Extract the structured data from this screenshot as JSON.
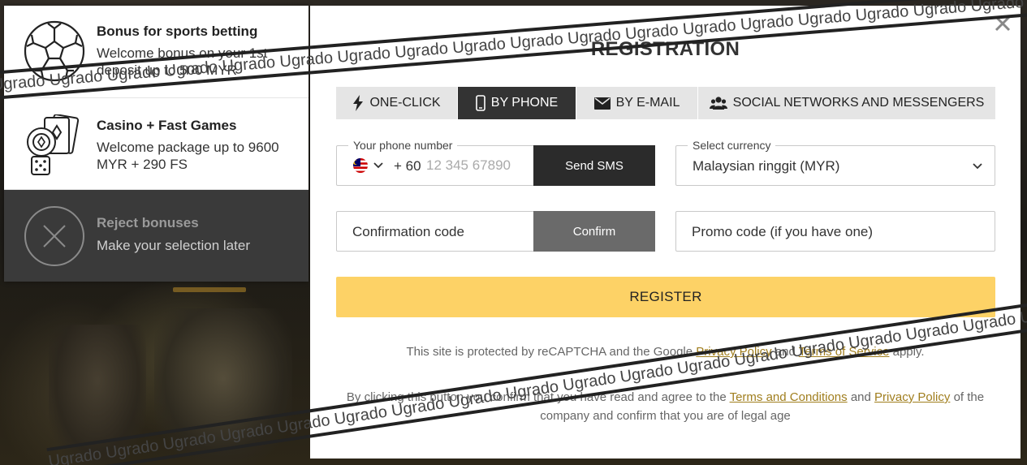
{
  "bonuses": [
    {
      "title": "Bonus for sports betting",
      "desc": "Welcome bonus on your 1st deposit up to 500 MYR",
      "icon": "soccer-ball-icon"
    },
    {
      "title": "Casino + Fast Games",
      "desc": "Welcome package up to 9600 MYR + 290 FS",
      "icon": "casino-chips-cards-dice-icon"
    },
    {
      "title": "Reject bonuses",
      "desc": "Make your selection later",
      "icon": "reject-circle-x-icon"
    }
  ],
  "modal": {
    "title": "REGISTRATION",
    "tabs": [
      {
        "label": "ONE-CLICK",
        "icon": "lightning-icon"
      },
      {
        "label": "BY PHONE",
        "icon": "phone-icon",
        "active": true
      },
      {
        "label": "BY E-MAIL",
        "icon": "envelope-icon"
      },
      {
        "label": "SOCIAL NETWORKS AND MESSENGERS",
        "icon": "users-icon"
      }
    ],
    "phone": {
      "label": "Your phone number",
      "country_code": "+ 60",
      "placeholder": "12 345 67890",
      "send_label": "Send SMS",
      "flag": "malaysia-flag-icon"
    },
    "currency": {
      "label": "Select currency",
      "value": "Malaysian ringgit (MYR)"
    },
    "confirmation": {
      "placeholder": "Confirmation code",
      "button_label": "Confirm"
    },
    "promo": {
      "placeholder": "Promo code (if you have one)"
    },
    "register_label": "REGISTER",
    "recaptcha": {
      "prefix": "This site is protected by reCAPTCHA and the Google",
      "privacy": "Privacy Policy",
      "and": "and",
      "terms": "Terms of Service",
      "suffix": "apply."
    },
    "agreement": {
      "prefix": "By clicking this button you confirm that you have read and agree to the",
      "terms": "Terms and Conditions",
      "and": "and",
      "privacy": "Privacy Policy",
      "suffix": "of the company and confirm that you are of legal age"
    }
  },
  "watermark": "Ugrado Ugrado Ugrado Ugrado Ugrado Ugrado Ugrado Ugrado Ugrado Ugrado Ugrado Ugrado Ugrado Ugrado Ugrado Ugrado Ugrado Ugrado Ugrado Ugrado",
  "colors": {
    "accent_yellow": "#fdd266",
    "link_gold": "#a07e1e",
    "dark": "#2b2b2b"
  }
}
